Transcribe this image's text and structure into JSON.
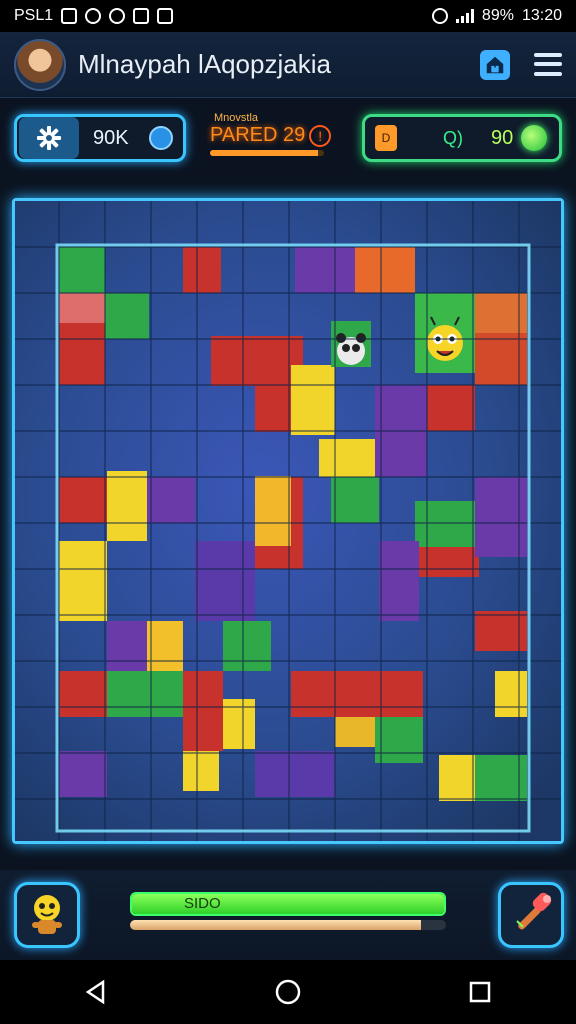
{
  "status_bar": {
    "carrier": "PSL1",
    "battery": "89%",
    "time": "13:20",
    "icons": [
      "notification-icon",
      "circle-icon",
      "settings-icon",
      "app-icon",
      "image-icon"
    ]
  },
  "header": {
    "title": "Mlnaypah lAqopzjakia",
    "menu_icon": "hamburger-menu-icon",
    "home_icon": "home-icon"
  },
  "hud": {
    "coins": "90K",
    "pared_small": "Mnovstla",
    "pared_label": "PARED 29",
    "pared_progress": 0.95,
    "score_tag": "D",
    "score_mid": "Q)",
    "score_value": "90"
  },
  "bottom": {
    "progress_label": "SIDO",
    "progress_fraction": 1.0,
    "sub_progress_fraction": 0.92
  },
  "colors": {
    "accent": "#39c6ff",
    "progress": "#3dff6a",
    "warning": "#ff8a1a"
  }
}
